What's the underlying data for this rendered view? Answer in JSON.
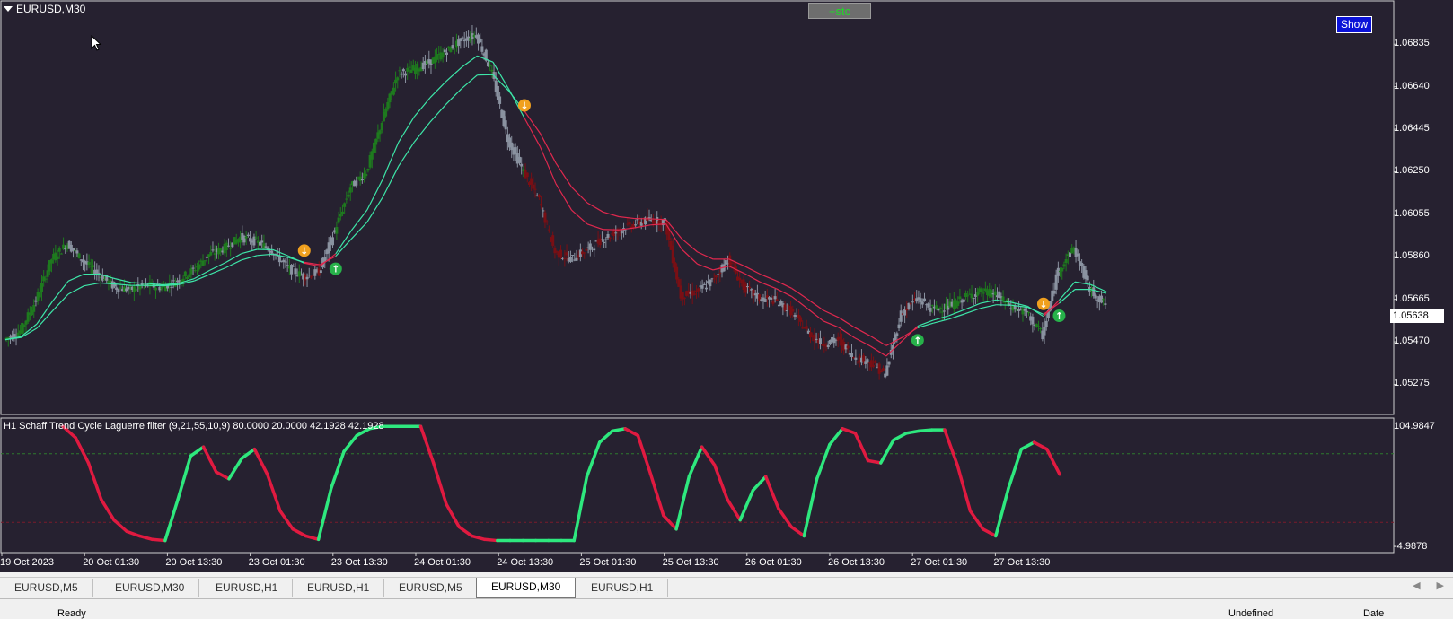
{
  "window": {
    "symbol_title": "EURUSD,M30"
  },
  "buttons": {
    "stc": "+stc",
    "show": "Show"
  },
  "price_axis": {
    "labels": [
      "1.06835",
      "1.06640",
      "1.06445",
      "1.06250",
      "1.06055",
      "1.05860",
      "1.05665",
      "1.05470",
      "1.05275"
    ],
    "current_price": "1.05638"
  },
  "indicator": {
    "label": "H1 Schaff Trend Cycle  Laguerre filter  (9,21,55,10,9) 80.0000 20.0000 42.1928 42.1928",
    "max_label": "104.9847",
    "min_label": "-4.9878",
    "levels": [
      80,
      20
    ]
  },
  "time_axis": {
    "labels": [
      "19 Oct 2023",
      "20 Oct 01:30",
      "20 Oct 13:30",
      "23 Oct 01:30",
      "23 Oct 13:30",
      "24 Oct 01:30",
      "24 Oct 13:30",
      "25 Oct 01:30",
      "25 Oct 13:30",
      "26 Oct 01:30",
      "26 Oct 13:30",
      "27 Oct 01:30",
      "27 Oct 13:30"
    ]
  },
  "tabs": [
    "EURUSD,M5",
    "EURUSD,M30",
    "EURUSD,H1",
    "EURUSD,H1",
    "EURUSD,M5",
    "EURUSD,M30",
    "EURUSD,H1"
  ],
  "active_tab_index": 5,
  "statusbar": {
    "left": "Ready",
    "right1": "Undefined",
    "right2": "Date"
  },
  "colors": {
    "background": "#262130",
    "bull_candle": "#1e7a1e",
    "bear_candle": "#7a0f14",
    "neutral_candle": "#8a92a0",
    "ma_up": "#3de6a8",
    "ma_down": "#e0284e",
    "stc_up": "#2ee87e",
    "stc_down": "#e01a40",
    "buy_arrow": "#27b24a",
    "sell_arrow": "#f0a01e"
  },
  "chart_data": {
    "type": "line",
    "price_range": [
      1.0517,
      1.0698
    ],
    "closes": [
      1.0548,
      1.0552,
      1.0566,
      1.0585,
      1.0592,
      1.0584,
      1.0578,
      1.0572,
      1.0571,
      1.0573,
      1.0572,
      1.0575,
      1.058,
      1.0587,
      1.059,
      1.0595,
      1.0593,
      1.0589,
      1.0581,
      1.0577,
      1.0579,
      1.0598,
      1.0618,
      1.0625,
      1.0648,
      1.067,
      1.0672,
      1.0675,
      1.068,
      1.0685,
      1.0688,
      1.067,
      1.064,
      1.0625,
      1.0612,
      1.0588,
      1.0585,
      1.0589,
      1.0594,
      1.0598,
      1.0601,
      1.0603,
      1.0602,
      1.0568,
      1.057,
      1.0575,
      1.0585,
      1.0572,
      1.0567,
      1.0566,
      1.0561,
      1.0552,
      1.0546,
      1.0548,
      1.054,
      1.0538,
      1.0532,
      1.056,
      1.0567,
      1.0562,
      1.0563,
      1.0567,
      1.057,
      1.0569,
      1.0563,
      1.056,
      1.055,
      1.058,
      1.059,
      1.0571,
      1.0564
    ],
    "stc": [
      104,
      94,
      72,
      40,
      22,
      12,
      8,
      5,
      4,
      40,
      78,
      86,
      64,
      58,
      76,
      84,
      62,
      30,
      14,
      8,
      5,
      50,
      82,
      96,
      102,
      104,
      104,
      104,
      104,
      72,
      36,
      16,
      8,
      5,
      4,
      4,
      4,
      4,
      4,
      4,
      4,
      60,
      90,
      100,
      102,
      96,
      62,
      26,
      14,
      60,
      86,
      70,
      40,
      22,
      48,
      60,
      32,
      16,
      8,
      58,
      88,
      102,
      98,
      74,
      72,
      92,
      98,
      100,
      101,
      101,
      70,
      30,
      14,
      8,
      50,
      84,
      90,
      84,
      62
    ]
  }
}
